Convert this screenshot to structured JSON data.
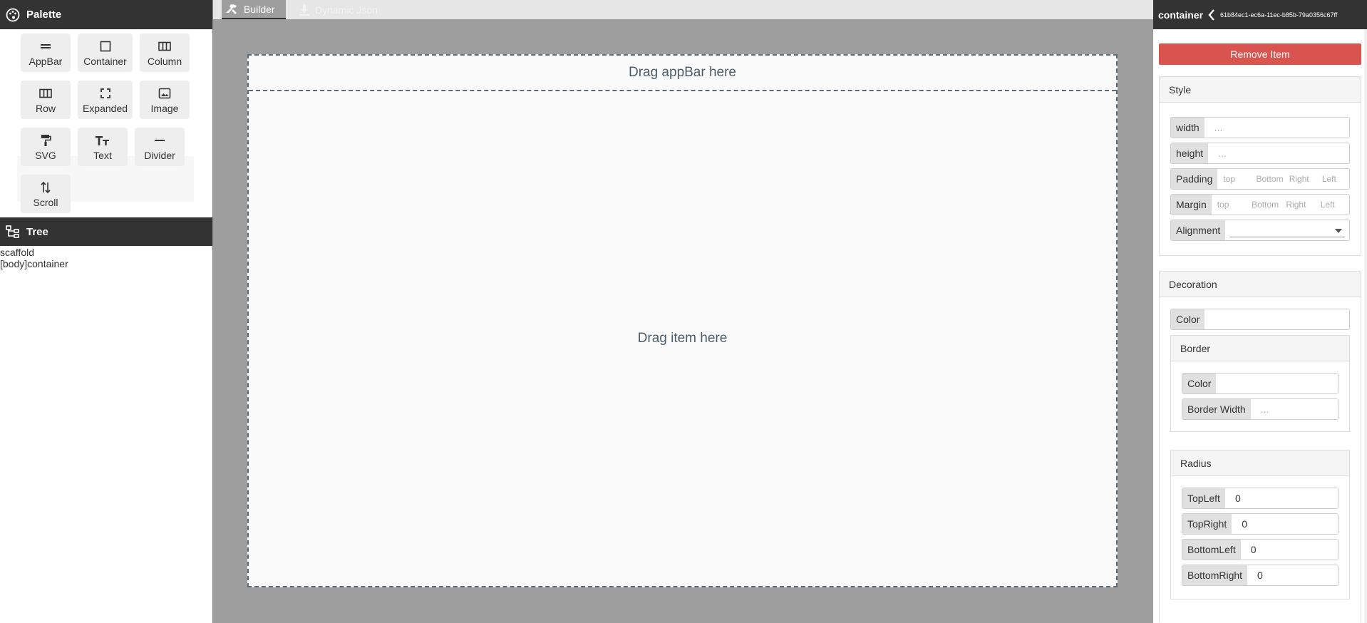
{
  "palette": {
    "title": "Palette",
    "items": [
      {
        "label": "AppBar",
        "icon": "appbar-icon"
      },
      {
        "label": "Container",
        "icon": "container-icon"
      },
      {
        "label": "Column",
        "icon": "column-icon"
      },
      {
        "label": "Row",
        "icon": "row-icon"
      },
      {
        "label": "Expanded",
        "icon": "expanded-icon"
      },
      {
        "label": "Image",
        "icon": "image-icon"
      },
      {
        "label": "SVG",
        "icon": "paint-roller-icon"
      },
      {
        "label": "Text",
        "icon": "text-icon"
      },
      {
        "label": "Divider",
        "icon": "divider-icon"
      },
      {
        "label": "Scroll",
        "icon": "scroll-icon"
      }
    ]
  },
  "tree": {
    "title": "Tree",
    "nodes": [
      "scaffold",
      "[body]container"
    ]
  },
  "tabs": {
    "builder": "Builder",
    "json": "Dynamic Json"
  },
  "canvas": {
    "appbar_placeholder": "Drag appBar here",
    "body_placeholder": "Drag item here"
  },
  "inspector": {
    "title": "container",
    "id": "61b84ec1-ec6a-11ec-b85b-79a0356c67ff",
    "remove_label": "Remove Item",
    "style": {
      "title": "Style",
      "width_label": "width",
      "width_placeholder": "...",
      "height_label": "height",
      "height_placeholder": "...",
      "padding_label": "Padding",
      "margin_label": "Margin",
      "edge_placeholders": {
        "top": "top",
        "bottom": "Bottom",
        "right": "Right",
        "left": "Left"
      },
      "alignment_label": "Alignment",
      "alignment_value": ""
    },
    "decoration": {
      "title": "Decoration",
      "color_label": "Color",
      "color_value": "",
      "border": {
        "title": "Border",
        "color_label": "Color",
        "color_value": "",
        "width_label": "Border Width",
        "width_placeholder": "..."
      },
      "radius": {
        "title": "Radius",
        "top_left_label": "TopLeft",
        "top_left_value": "0",
        "top_right_label": "TopRight",
        "top_right_value": "0",
        "bottom_left_label": "BottomLeft",
        "bottom_left_value": "0",
        "bottom_right_label": "BottomRight",
        "bottom_right_value": "0"
      }
    }
  },
  "colors": {
    "header_bg": "#333333",
    "canvas_bg": "#9e9e9e",
    "remove_button": "#d9534f",
    "dashed_border": "#5d6d78"
  }
}
